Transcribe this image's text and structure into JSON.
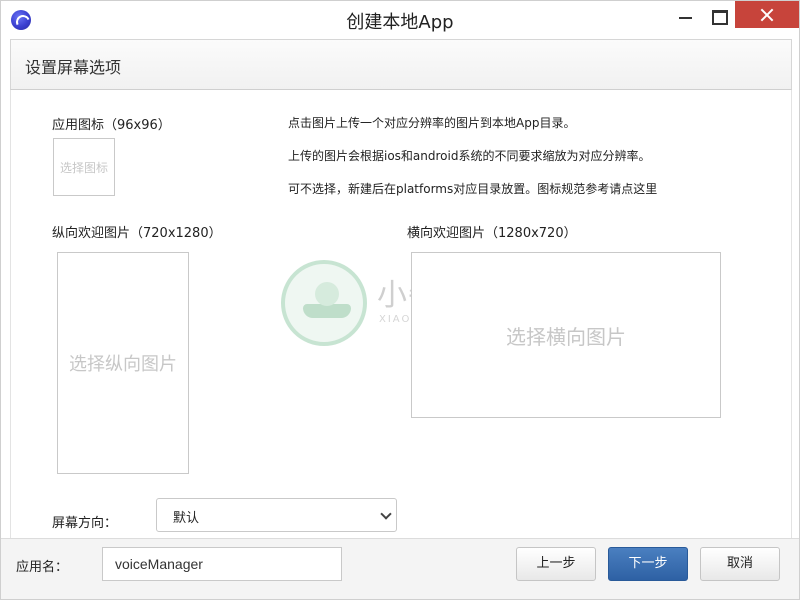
{
  "window": {
    "title": "创建本地App",
    "app_icon": "app-logo-icon"
  },
  "header": {
    "title": "设置屏幕选项"
  },
  "icon_section": {
    "label": "应用图标（96x96）",
    "picker_text": "选择图标"
  },
  "info": {
    "line1": "点击图片上传一个对应分辨率的图片到本地App目录。",
    "line2": "上传的图片会根据ios和android系统的不同要求缩放为对应分辨率。",
    "line3": "可不选择，新建后在platforms对应目录放置。图标规范参考请点这里"
  },
  "portrait": {
    "label": "纵向欢迎图片（720x1280）",
    "picker_text": "选择纵向图片"
  },
  "landscape": {
    "label": "横向欢迎图片（1280x720）",
    "picker_text": "选择横向图片"
  },
  "orientation": {
    "label": "屏幕方向：",
    "selected": "默认"
  },
  "watermark": {
    "text": "小牛知识库",
    "sub": "XIAO NIU ZHI SHI KU"
  },
  "footer": {
    "name_label": "应用名：",
    "name_value": "voiceManager",
    "prev_label": "上一步",
    "next_label": "下一步",
    "cancel_label": "取消"
  },
  "colors": {
    "close_button": "#c7443b",
    "primary_button": "#2e61a4"
  }
}
